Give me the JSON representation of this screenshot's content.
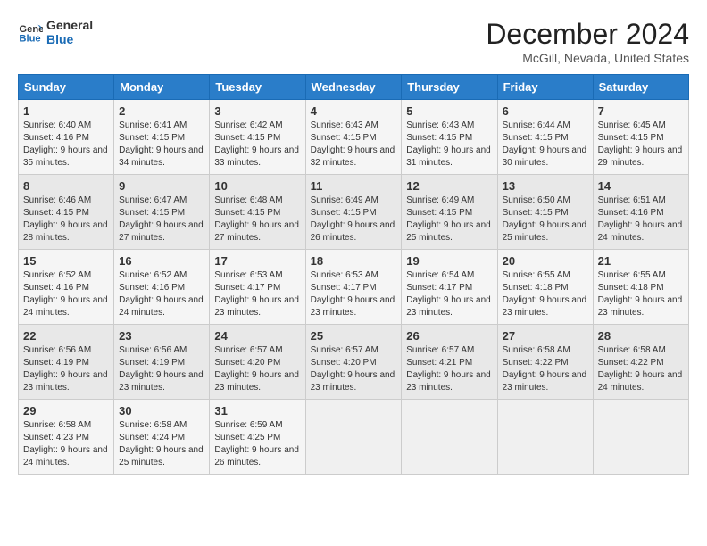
{
  "header": {
    "logo_line1": "General",
    "logo_line2": "Blue",
    "title": "December 2024",
    "location": "McGill, Nevada, United States"
  },
  "weekdays": [
    "Sunday",
    "Monday",
    "Tuesday",
    "Wednesday",
    "Thursday",
    "Friday",
    "Saturday"
  ],
  "weeks": [
    [
      {
        "day": "1",
        "sunrise": "Sunrise: 6:40 AM",
        "sunset": "Sunset: 4:16 PM",
        "daylight": "Daylight: 9 hours and 35 minutes."
      },
      {
        "day": "2",
        "sunrise": "Sunrise: 6:41 AM",
        "sunset": "Sunset: 4:15 PM",
        "daylight": "Daylight: 9 hours and 34 minutes."
      },
      {
        "day": "3",
        "sunrise": "Sunrise: 6:42 AM",
        "sunset": "Sunset: 4:15 PM",
        "daylight": "Daylight: 9 hours and 33 minutes."
      },
      {
        "day": "4",
        "sunrise": "Sunrise: 6:43 AM",
        "sunset": "Sunset: 4:15 PM",
        "daylight": "Daylight: 9 hours and 32 minutes."
      },
      {
        "day": "5",
        "sunrise": "Sunrise: 6:43 AM",
        "sunset": "Sunset: 4:15 PM",
        "daylight": "Daylight: 9 hours and 31 minutes."
      },
      {
        "day": "6",
        "sunrise": "Sunrise: 6:44 AM",
        "sunset": "Sunset: 4:15 PM",
        "daylight": "Daylight: 9 hours and 30 minutes."
      },
      {
        "day": "7",
        "sunrise": "Sunrise: 6:45 AM",
        "sunset": "Sunset: 4:15 PM",
        "daylight": "Daylight: 9 hours and 29 minutes."
      }
    ],
    [
      {
        "day": "8",
        "sunrise": "Sunrise: 6:46 AM",
        "sunset": "Sunset: 4:15 PM",
        "daylight": "Daylight: 9 hours and 28 minutes."
      },
      {
        "day": "9",
        "sunrise": "Sunrise: 6:47 AM",
        "sunset": "Sunset: 4:15 PM",
        "daylight": "Daylight: 9 hours and 27 minutes."
      },
      {
        "day": "10",
        "sunrise": "Sunrise: 6:48 AM",
        "sunset": "Sunset: 4:15 PM",
        "daylight": "Daylight: 9 hours and 27 minutes."
      },
      {
        "day": "11",
        "sunrise": "Sunrise: 6:49 AM",
        "sunset": "Sunset: 4:15 PM",
        "daylight": "Daylight: 9 hours and 26 minutes."
      },
      {
        "day": "12",
        "sunrise": "Sunrise: 6:49 AM",
        "sunset": "Sunset: 4:15 PM",
        "daylight": "Daylight: 9 hours and 25 minutes."
      },
      {
        "day": "13",
        "sunrise": "Sunrise: 6:50 AM",
        "sunset": "Sunset: 4:15 PM",
        "daylight": "Daylight: 9 hours and 25 minutes."
      },
      {
        "day": "14",
        "sunrise": "Sunrise: 6:51 AM",
        "sunset": "Sunset: 4:16 PM",
        "daylight": "Daylight: 9 hours and 24 minutes."
      }
    ],
    [
      {
        "day": "15",
        "sunrise": "Sunrise: 6:52 AM",
        "sunset": "Sunset: 4:16 PM",
        "daylight": "Daylight: 9 hours and 24 minutes."
      },
      {
        "day": "16",
        "sunrise": "Sunrise: 6:52 AM",
        "sunset": "Sunset: 4:16 PM",
        "daylight": "Daylight: 9 hours and 24 minutes."
      },
      {
        "day": "17",
        "sunrise": "Sunrise: 6:53 AM",
        "sunset": "Sunset: 4:17 PM",
        "daylight": "Daylight: 9 hours and 23 minutes."
      },
      {
        "day": "18",
        "sunrise": "Sunrise: 6:53 AM",
        "sunset": "Sunset: 4:17 PM",
        "daylight": "Daylight: 9 hours and 23 minutes."
      },
      {
        "day": "19",
        "sunrise": "Sunrise: 6:54 AM",
        "sunset": "Sunset: 4:17 PM",
        "daylight": "Daylight: 9 hours and 23 minutes."
      },
      {
        "day": "20",
        "sunrise": "Sunrise: 6:55 AM",
        "sunset": "Sunset: 4:18 PM",
        "daylight": "Daylight: 9 hours and 23 minutes."
      },
      {
        "day": "21",
        "sunrise": "Sunrise: 6:55 AM",
        "sunset": "Sunset: 4:18 PM",
        "daylight": "Daylight: 9 hours and 23 minutes."
      }
    ],
    [
      {
        "day": "22",
        "sunrise": "Sunrise: 6:56 AM",
        "sunset": "Sunset: 4:19 PM",
        "daylight": "Daylight: 9 hours and 23 minutes."
      },
      {
        "day": "23",
        "sunrise": "Sunrise: 6:56 AM",
        "sunset": "Sunset: 4:19 PM",
        "daylight": "Daylight: 9 hours and 23 minutes."
      },
      {
        "day": "24",
        "sunrise": "Sunrise: 6:57 AM",
        "sunset": "Sunset: 4:20 PM",
        "daylight": "Daylight: 9 hours and 23 minutes."
      },
      {
        "day": "25",
        "sunrise": "Sunrise: 6:57 AM",
        "sunset": "Sunset: 4:20 PM",
        "daylight": "Daylight: 9 hours and 23 minutes."
      },
      {
        "day": "26",
        "sunrise": "Sunrise: 6:57 AM",
        "sunset": "Sunset: 4:21 PM",
        "daylight": "Daylight: 9 hours and 23 minutes."
      },
      {
        "day": "27",
        "sunrise": "Sunrise: 6:58 AM",
        "sunset": "Sunset: 4:22 PM",
        "daylight": "Daylight: 9 hours and 23 minutes."
      },
      {
        "day": "28",
        "sunrise": "Sunrise: 6:58 AM",
        "sunset": "Sunset: 4:22 PM",
        "daylight": "Daylight: 9 hours and 24 minutes."
      }
    ],
    [
      {
        "day": "29",
        "sunrise": "Sunrise: 6:58 AM",
        "sunset": "Sunset: 4:23 PM",
        "daylight": "Daylight: 9 hours and 24 minutes."
      },
      {
        "day": "30",
        "sunrise": "Sunrise: 6:58 AM",
        "sunset": "Sunset: 4:24 PM",
        "daylight": "Daylight: 9 hours and 25 minutes."
      },
      {
        "day": "31",
        "sunrise": "Sunrise: 6:59 AM",
        "sunset": "Sunset: 4:25 PM",
        "daylight": "Daylight: 9 hours and 26 minutes."
      },
      null,
      null,
      null,
      null
    ]
  ]
}
